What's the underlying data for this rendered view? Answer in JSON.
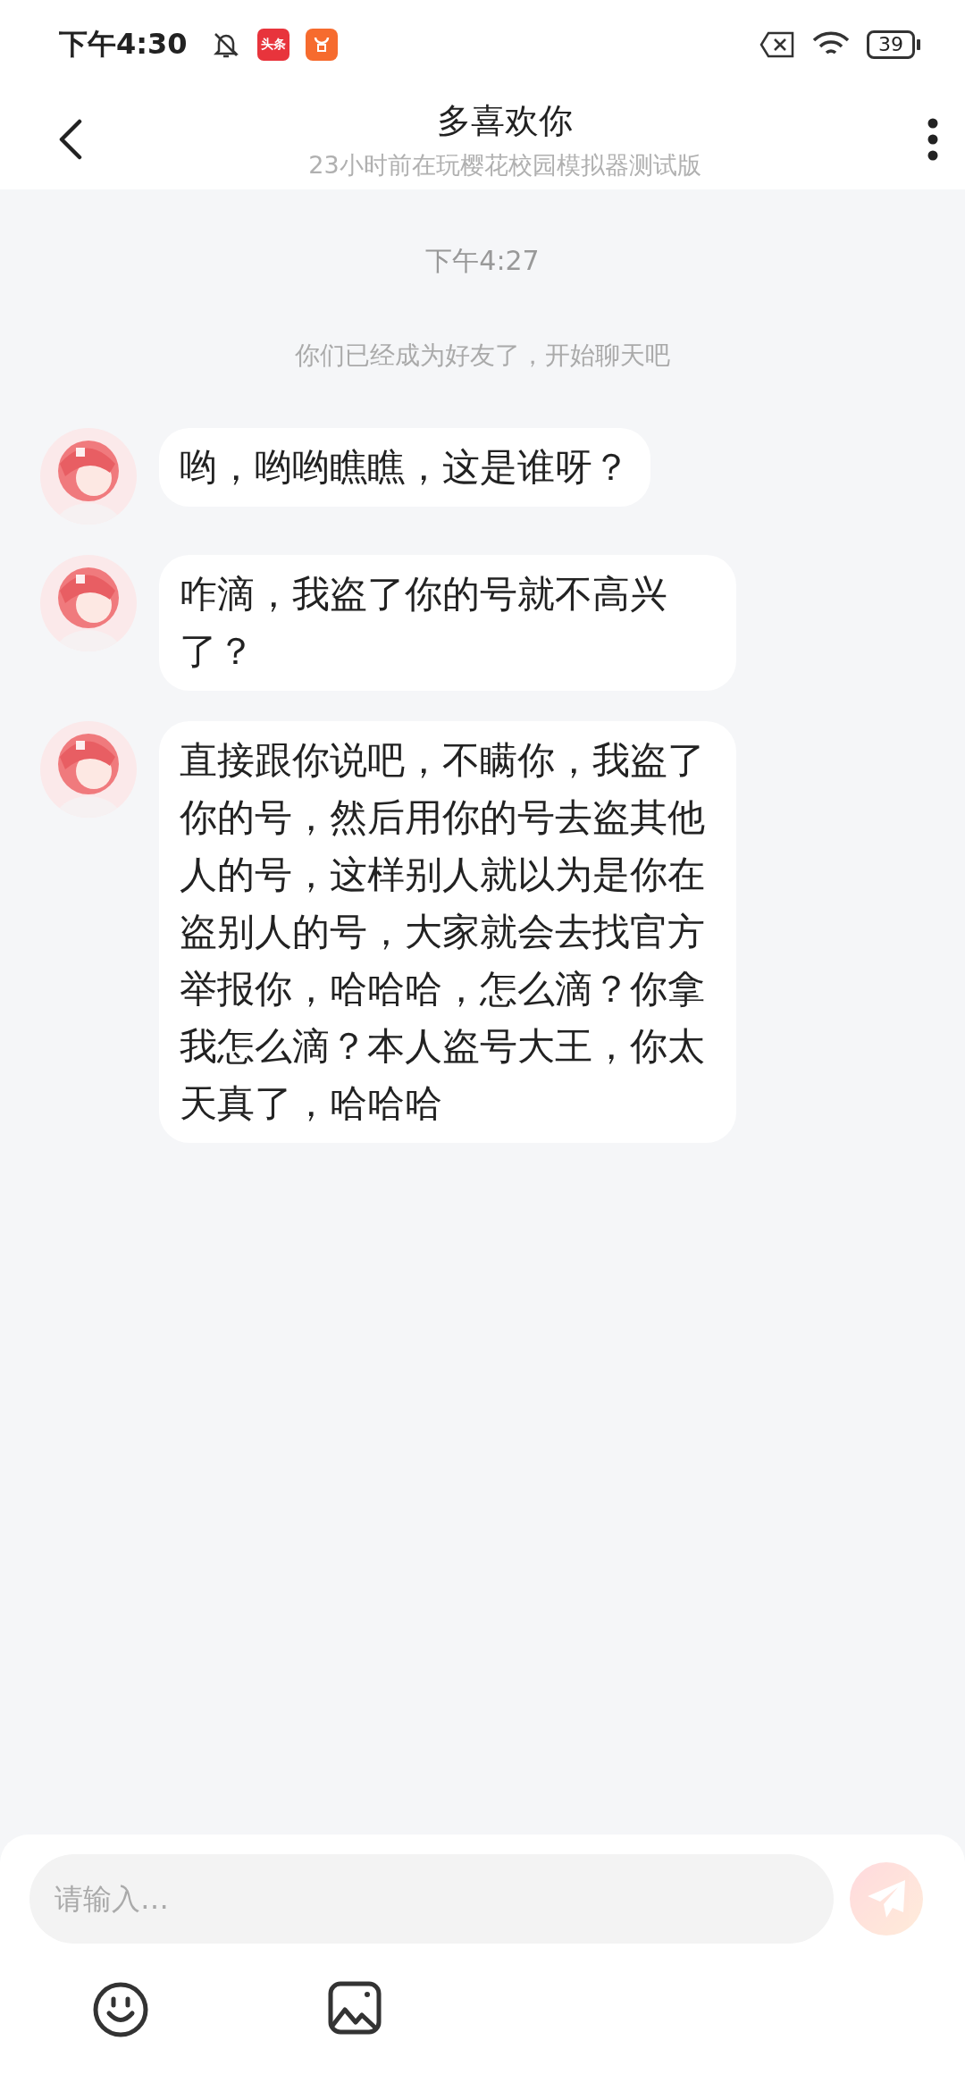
{
  "status_bar": {
    "time": "下午4:30",
    "app_badge": "头条",
    "battery": "39"
  },
  "header": {
    "title": "多喜欢你",
    "subtitle": "23小时前在玩樱花校园模拟器测试版"
  },
  "chat": {
    "timestamp": "下午4:27",
    "system_message": "你们已经成为好友了，开始聊天吧",
    "messages": [
      {
        "text": "哟，哟哟瞧瞧，这是谁呀？"
      },
      {
        "text": "咋滴，我盗了你的号就不高兴了？"
      },
      {
        "text": "直接跟你说吧，不瞒你，我盗了你的号，然后用你的号去盗其他人的号，这样别人就以为是你在盗别人的号，大家就会去找官方举报你，哈哈哈，怎么滴？你拿我怎么滴？本人盗号大王，你太天真了，哈哈哈"
      }
    ]
  },
  "input_bar": {
    "placeholder": "请输入…",
    "send_disabled": true
  }
}
